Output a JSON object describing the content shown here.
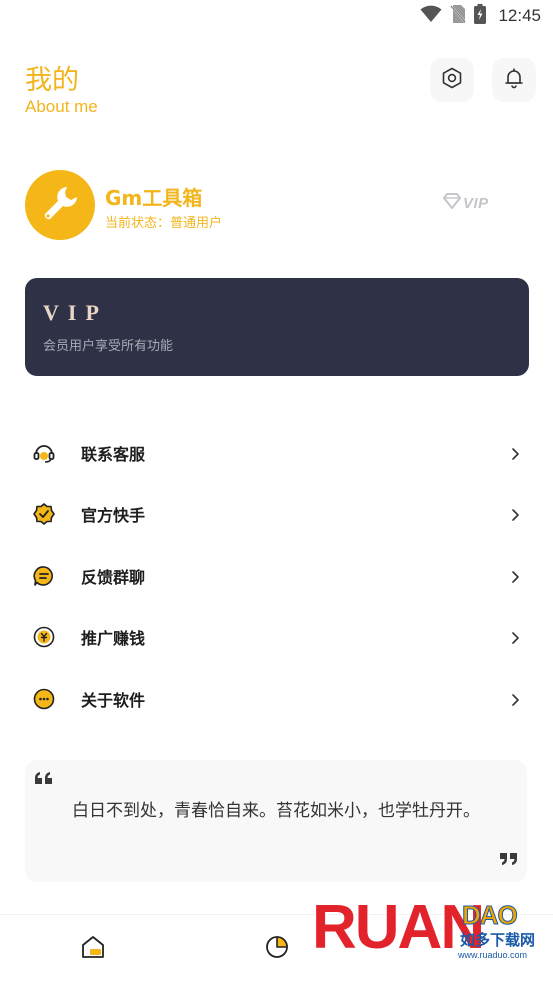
{
  "status_bar": {
    "time": "12:45",
    "icons": [
      "wifi-icon",
      "no-sim-icon",
      "battery-charging-icon"
    ]
  },
  "header": {
    "title": "我的",
    "subtitle": "About me",
    "icons": [
      "settings-icon",
      "bell-icon"
    ]
  },
  "profile": {
    "app_name": "Gm工具箱",
    "status_label": "当前状态：",
    "status_value": "普通用户",
    "badge": "VIP",
    "avatar_icon": "wrench-icon"
  },
  "vip_card": {
    "title": "VIP",
    "description": "会员用户享受所有功能"
  },
  "menu": {
    "items": [
      {
        "label": "联系客服",
        "icon": "customer-service-icon"
      },
      {
        "label": "官方快手",
        "icon": "badge-check-icon"
      },
      {
        "label": "反馈群聊",
        "icon": "chat-group-icon"
      },
      {
        "label": "推广赚钱",
        "icon": "coin-yuan-icon"
      },
      {
        "label": "关于软件",
        "icon": "about-smile-icon"
      }
    ]
  },
  "quote": {
    "text": "白日不到处，青春恰自来。苔花如米小，也学牡丹开。"
  },
  "bottom_nav": {
    "items": [
      "home-icon",
      "stats-icon"
    ]
  },
  "watermark": {
    "brand": "RUAN",
    "brand_small": "DAO",
    "cn": "如多下载网",
    "url": "www.ruaduo.com"
  },
  "colors": {
    "accent": "#f2b51c",
    "vip_card_bg": "#2f3246",
    "vip_title": "#e9d7c5"
  }
}
